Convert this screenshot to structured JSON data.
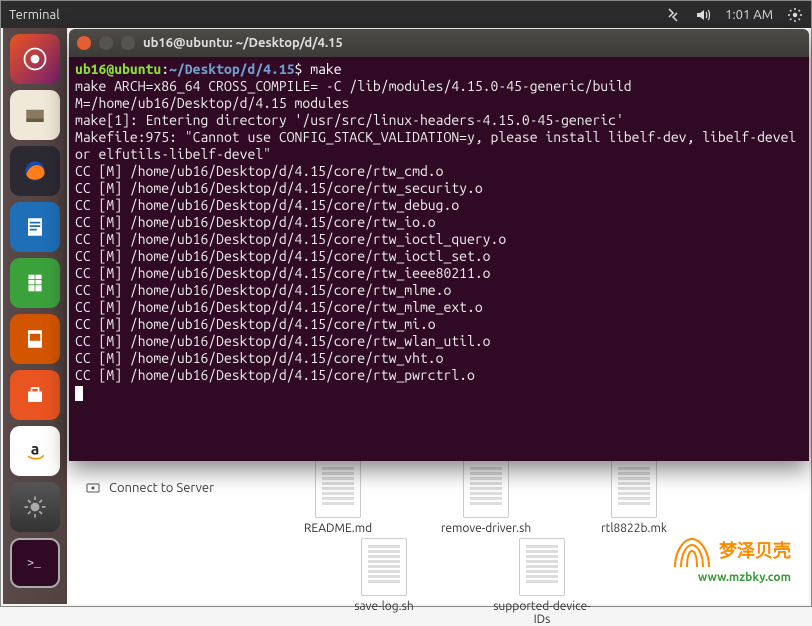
{
  "menubar": {
    "app_title": "Terminal",
    "time": "1:01 AM"
  },
  "terminal": {
    "title": "ub16@ubuntu: ~/Desktop/d/4.15",
    "prompt_user": "ub16@ubuntu",
    "prompt_path": "~/Desktop/d/4.15",
    "prompt_symbol": "$",
    "command": "make",
    "lines": [
      "make ARCH=x86_64 CROSS_COMPILE= -C /lib/modules/4.15.0-45-generic/build M=/home/ub16/Desktop/d/4.15  modules",
      "make[1]: Entering directory '/usr/src/linux-headers-4.15.0-45-generic'",
      "Makefile:975: \"Cannot use CONFIG_STACK_VALIDATION=y, please install libelf-dev, libelf-devel or elfutils-libelf-devel\"",
      "  CC [M]  /home/ub16/Desktop/d/4.15/core/rtw_cmd.o",
      "  CC [M]  /home/ub16/Desktop/d/4.15/core/rtw_security.o",
      "  CC [M]  /home/ub16/Desktop/d/4.15/core/rtw_debug.o",
      "  CC [M]  /home/ub16/Desktop/d/4.15/core/rtw_io.o",
      "  CC [M]  /home/ub16/Desktop/d/4.15/core/rtw_ioctl_query.o",
      "  CC [M]  /home/ub16/Desktop/d/4.15/core/rtw_ioctl_set.o",
      "  CC [M]  /home/ub16/Desktop/d/4.15/core/rtw_ieee80211.o",
      "  CC [M]  /home/ub16/Desktop/d/4.15/core/rtw_mlme.o",
      "  CC [M]  /home/ub16/Desktop/d/4.15/core/rtw_mlme_ext.o",
      "  CC [M]  /home/ub16/Desktop/d/4.15/core/rtw_mi.o",
      "  CC [M]  /home/ub16/Desktop/d/4.15/core/rtw_wlan_util.o",
      "  CC [M]  /home/ub16/Desktop/d/4.15/core/rtw_vht.o",
      "  CC [M]  /home/ub16/Desktop/d/4.15/core/rtw_pwrctrl.o"
    ]
  },
  "desktop": {
    "connect_server": "Connect to Server",
    "files_row1": [
      "README.md",
      "remove-driver.sh",
      "rtl8822b.mk"
    ],
    "files_row2": [
      "save-log.sh",
      "supported-device-IDs"
    ]
  },
  "watermark": {
    "text": "梦泽贝壳",
    "url": "www.mzbky.com"
  }
}
